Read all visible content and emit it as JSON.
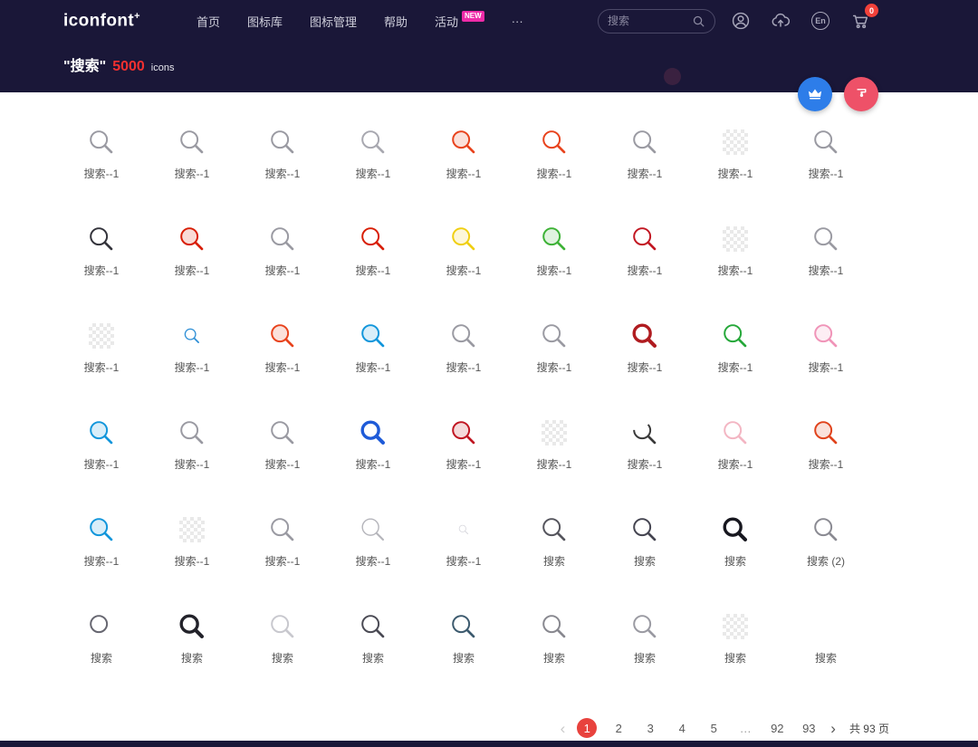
{
  "header": {
    "logo": "iconfont",
    "logo_sup": "+",
    "nav": [
      {
        "label": "首页"
      },
      {
        "label": "图标库"
      },
      {
        "label": "图标管理"
      },
      {
        "label": "帮助"
      },
      {
        "label": "活动",
        "badge": "NEW"
      },
      {
        "label": "···"
      }
    ],
    "search_placeholder": "搜索",
    "lang_label": "En",
    "cart_badge": "0"
  },
  "banner": {
    "query": "\"搜索\"",
    "count": "5000",
    "unit": "icons"
  },
  "fabs": {
    "crown_color": "#2d7de9",
    "paint_color": "#ee5168"
  },
  "grid": {
    "items": [
      {
        "label": "搜索--1",
        "color": "#9a9aa2",
        "variant": "outline"
      },
      {
        "label": "搜索--1",
        "color": "#9a9aa2",
        "variant": "outline"
      },
      {
        "label": "搜索--1",
        "color": "#9a9aa2",
        "variant": "outline"
      },
      {
        "label": "搜索--1",
        "color": "#a8a8b0",
        "variant": "outline"
      },
      {
        "label": "搜索--1",
        "color": "#e8431d",
        "variant": "tint"
      },
      {
        "label": "搜索--1",
        "color": "#e8431d",
        "variant": "outline"
      },
      {
        "label": "搜索--1",
        "color": "#9a9aa2",
        "variant": "outline"
      },
      {
        "label": "搜索--1",
        "variant": "checker"
      },
      {
        "label": "搜索--1",
        "color": "#9a9aa2",
        "variant": "outline"
      },
      {
        "label": "搜索--1",
        "color": "#33333b",
        "variant": "outline"
      },
      {
        "label": "搜索--1",
        "color": "#d81e06",
        "variant": "tint"
      },
      {
        "label": "搜索--1",
        "color": "#9a9aa2",
        "variant": "outline"
      },
      {
        "label": "搜索--1",
        "color": "#d81e06",
        "variant": "outline"
      },
      {
        "label": "搜索--1",
        "color": "#f0cf12",
        "variant": "tint"
      },
      {
        "label": "搜索--1",
        "color": "#3db236",
        "variant": "tint"
      },
      {
        "label": "搜索--1",
        "color": "#c21722",
        "variant": "outline"
      },
      {
        "label": "搜索--1",
        "variant": "checker"
      },
      {
        "label": "搜索--1",
        "color": "#9a9aa2",
        "variant": "outline"
      },
      {
        "label": "搜索--1",
        "variant": "checker"
      },
      {
        "label": "搜索--1",
        "color": "#2e8fd6",
        "variant": "small"
      },
      {
        "label": "搜索--1",
        "color": "#e8431d",
        "variant": "tint"
      },
      {
        "label": "搜索--1",
        "color": "#1296db",
        "variant": "tint"
      },
      {
        "label": "搜索--1",
        "color": "#9a9aa2",
        "variant": "outline"
      },
      {
        "label": "搜索--1",
        "color": "#9a9aa2",
        "variant": "outline"
      },
      {
        "label": "搜索--1",
        "color": "#b01c20",
        "variant": "bold"
      },
      {
        "label": "搜索--1",
        "color": "#26a83a",
        "variant": "outline"
      },
      {
        "label": "搜索--1",
        "color": "#f094b8",
        "variant": "tint"
      },
      {
        "label": "搜索--1",
        "color": "#1296db",
        "variant": "tint"
      },
      {
        "label": "搜索--1",
        "color": "#9a9aa2",
        "variant": "outline"
      },
      {
        "label": "搜索--1",
        "color": "#9a9aa2",
        "variant": "outline"
      },
      {
        "label": "搜索--1",
        "color": "#1f5bd8",
        "variant": "bold"
      },
      {
        "label": "搜索--1",
        "color": "#c01622",
        "variant": "tint"
      },
      {
        "label": "搜索--1",
        "variant": "checker"
      },
      {
        "label": "搜索--1",
        "color": "#3a3a3a",
        "variant": "partial"
      },
      {
        "label": "搜索--1",
        "color": "#f3b6c3",
        "variant": "outline"
      },
      {
        "label": "搜索--1",
        "color": "#e0431c",
        "variant": "tint"
      },
      {
        "label": "搜索--1",
        "color": "#1296db",
        "variant": "tint"
      },
      {
        "label": "搜索--1",
        "variant": "checker"
      },
      {
        "label": "搜索--1",
        "color": "#9a9aa2",
        "variant": "outline"
      },
      {
        "label": "搜索--1",
        "color": "#b5b5bb",
        "variant": "thin"
      },
      {
        "label": "搜索--1",
        "color": "#d8d8de",
        "variant": "faint"
      },
      {
        "label": "搜索",
        "color": "#55555d",
        "variant": "outline"
      },
      {
        "label": "搜索",
        "color": "#444450",
        "variant": "outline"
      },
      {
        "label": "搜索",
        "color": "#17171f",
        "variant": "bold"
      },
      {
        "label": "搜索 (2)",
        "color": "#8a8a92",
        "variant": "outline"
      },
      {
        "label": "搜索",
        "color": "#666670",
        "variant": "circle"
      },
      {
        "label": "搜索",
        "color": "#22222a",
        "variant": "bold"
      },
      {
        "label": "搜索",
        "color": "#c8c8ce",
        "variant": "outline"
      },
      {
        "label": "搜索",
        "color": "#4a4a54",
        "variant": "outline"
      },
      {
        "label": "搜索",
        "color": "#3c5a6e",
        "variant": "outline"
      },
      {
        "label": "搜索",
        "color": "#88888f",
        "variant": "outline"
      },
      {
        "label": "搜索",
        "color": "#9a9aa2",
        "variant": "outline"
      },
      {
        "label": "搜索",
        "variant": "checker"
      },
      {
        "label": "搜索",
        "variant": "blank"
      }
    ]
  },
  "pagination": {
    "prev": "‹",
    "next": "›",
    "pages": [
      "1",
      "2",
      "3",
      "4",
      "5",
      "…",
      "92",
      "93"
    ],
    "active_index": 0,
    "total_label": "共 93 页"
  }
}
